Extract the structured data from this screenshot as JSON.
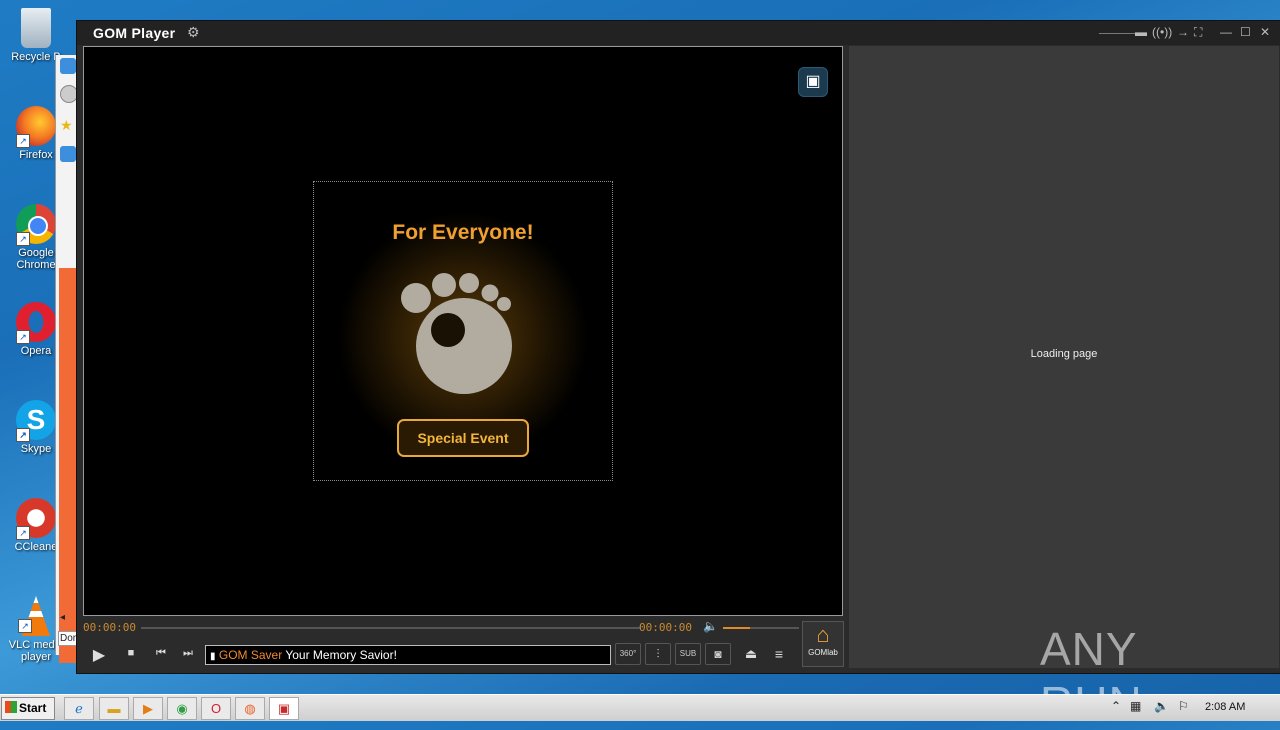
{
  "desktop": {
    "icons": [
      {
        "label": "Recycle B",
        "icon": "recycle-bin-icon",
        "color": "#cfd8e0"
      },
      {
        "label": "Firefox",
        "icon": "firefox-icon",
        "color": "#e8622a"
      },
      {
        "label": "Google Chrome",
        "icon": "chrome-icon",
        "color": "#2f9e44"
      },
      {
        "label": "Opera",
        "icon": "opera-icon",
        "color": "#d81e2a"
      },
      {
        "label": "Skype",
        "icon": "skype-icon",
        "color": "#14a0e6"
      },
      {
        "label": "CCleane",
        "icon": "ccleaner-icon",
        "color": "#d93a2a"
      },
      {
        "label": "VLC media player",
        "icon": "vlc-icon",
        "color": "#f07a0c"
      }
    ],
    "bg_window_label": "Dor"
  },
  "gom": {
    "title": "GOM Player",
    "promo_title": "For Everyone!",
    "event_button": "Special Event",
    "side_panel_text": "Loading page",
    "time_elapsed": "00:00:00",
    "time_total": "00:00:00",
    "volume": 0.35,
    "progress": 0.0,
    "marquee_highlight": "GOM Saver",
    "marquee_text": " Your Memory Savior!",
    "btn_360": "360°",
    "btn_sub": "SUB",
    "gomlab_label": "GOMlab",
    "accent_color": "#f0a030"
  },
  "taskbar": {
    "start_label": "Start",
    "clock": "2:08 AM"
  },
  "watermark": "ANY RUN"
}
